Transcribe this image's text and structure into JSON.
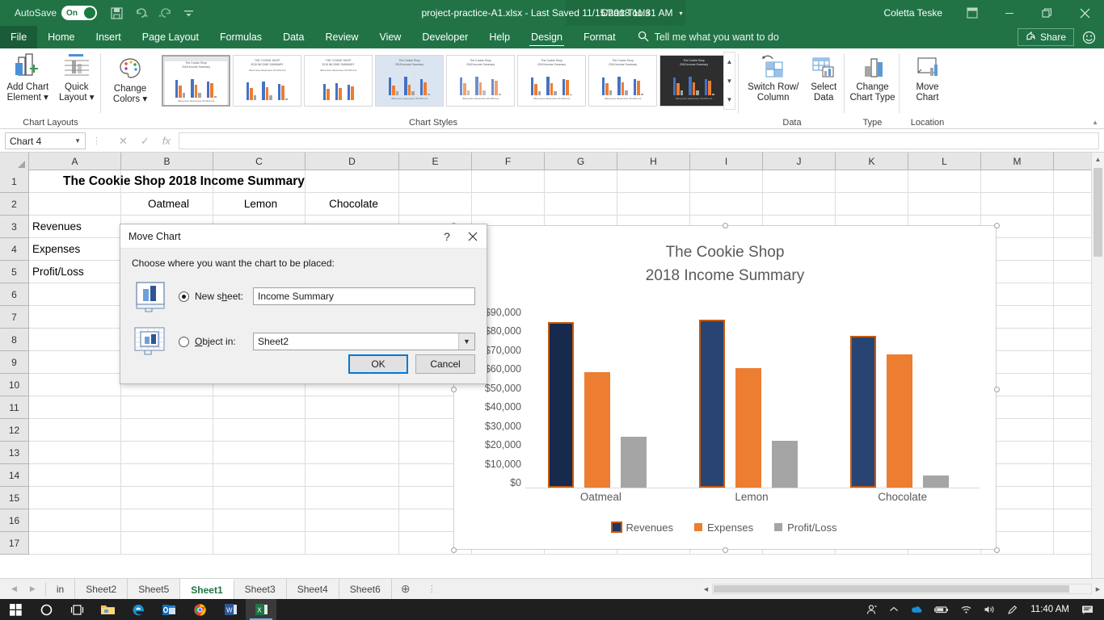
{
  "titlebar": {
    "autosave_label": "AutoSave",
    "autosave_state": "On",
    "document_title": "project-practice-A1.xlsx  -  Last Saved 11/15/2018 11:31 AM",
    "context_tab_group": "Chart Tools",
    "user_name": "Coletta Teske",
    "icons": {
      "save": "save-icon",
      "undo": "undo-icon",
      "redo": "redo-icon",
      "customize": "customize-qat-icon",
      "ribbon_display": "ribbon-display-options-icon",
      "minimize": "minimize-icon",
      "restore": "restore-icon",
      "close": "close-icon"
    }
  },
  "ribbon_tabs": {
    "items": [
      "File",
      "Home",
      "Insert",
      "Page Layout",
      "Formulas",
      "Data",
      "Review",
      "View",
      "Developer",
      "Help"
    ],
    "context_items": [
      "Design",
      "Format"
    ],
    "active_context": "Design",
    "tell_me": "Tell me what you want to do",
    "share_label": "Share"
  },
  "ribbon": {
    "groups": [
      {
        "name": "Chart Layouts",
        "label": "Chart Layouts",
        "buttons": [
          {
            "label_line1": "Add Chart",
            "label_line2": "Element",
            "dropdown": true,
            "icon": "add-chart-element-icon"
          },
          {
            "label_line1": "Quick",
            "label_line2": "Layout",
            "dropdown": true,
            "icon": "quick-layout-icon"
          }
        ]
      },
      {
        "name": "Chart Styles",
        "label": "Chart Styles",
        "buttons": [
          {
            "label_line1": "Change",
            "label_line2": "Colors",
            "dropdown": true,
            "icon": "change-colors-icon"
          }
        ],
        "gallery_count": 8,
        "selected_style_index": 0
      },
      {
        "name": "Data",
        "label": "Data",
        "buttons": [
          {
            "label_line1": "Switch Row/",
            "label_line2": "Column",
            "dropdown": false,
            "icon": "switch-row-column-icon"
          },
          {
            "label_line1": "Select",
            "label_line2": "Data",
            "dropdown": false,
            "icon": "select-data-icon"
          }
        ]
      },
      {
        "name": "Type",
        "label": "Type",
        "buttons": [
          {
            "label_line1": "Change",
            "label_line2": "Chart Type",
            "dropdown": false,
            "icon": "change-chart-type-icon"
          }
        ]
      },
      {
        "name": "Location",
        "label": "Location",
        "buttons": [
          {
            "label_line1": "Move",
            "label_line2": "Chart",
            "dropdown": false,
            "icon": "move-chart-icon"
          }
        ]
      }
    ]
  },
  "formula_bar": {
    "name_box_value": "Chart 4",
    "formula_value": "",
    "cancel_icon": "cancel-icon",
    "enter_icon": "enter-icon",
    "function_icon": "insert-function-icon"
  },
  "grid": {
    "columns": [
      "A",
      "B",
      "C",
      "D",
      "E",
      "F",
      "G",
      "H",
      "I",
      "J",
      "K",
      "L",
      "M"
    ],
    "rows": [
      "1",
      "2",
      "3",
      "4",
      "5",
      "6",
      "7",
      "8",
      "9",
      "10",
      "11",
      "12",
      "13",
      "14",
      "15",
      "16",
      "17"
    ],
    "cells": {
      "title_a1": "The Cookie Shop 2018 Income Summary",
      "header_b2": "Oatmeal",
      "header_c2": "Lemon",
      "header_d2": "Chocolate",
      "label_a3": "Revenues",
      "label_a4": "Expenses",
      "label_a5": "Profit/Loss"
    }
  },
  "chart_data": {
    "type": "bar",
    "title": "The Cookie Shop",
    "subtitle": "2018 Income Summary",
    "categories": [
      "Oatmeal",
      "Lemon",
      "Chocolate"
    ],
    "series": [
      {
        "name": "Revenues",
        "values": [
          82000,
          83000,
          75000
        ],
        "color": "#1F3864"
      },
      {
        "name": "Expenses",
        "values": [
          57000,
          59000,
          66000
        ],
        "color": "#ED7D31"
      },
      {
        "name": "Profit/Loss",
        "values": [
          25000,
          23000,
          6000
        ],
        "color": "#A5A5A5"
      }
    ],
    "ytick_labels": [
      "$90,000",
      "$80,000",
      "$70,000",
      "$60,000",
      "$50,000",
      "$40,000",
      "$30,000",
      "$20,000",
      "$10,000",
      "$0"
    ],
    "ylim": [
      0,
      90000
    ],
    "xlabel": "",
    "ylabel": "",
    "grid": false,
    "legend_position": "bottom",
    "selected_series": "Revenues",
    "selection_border_color": "#C55A11"
  },
  "dialog": {
    "title": "Move Chart",
    "help_icon": "help-icon",
    "close_icon": "close-icon",
    "prompt": "Choose where you want the chart to be placed:",
    "options": [
      {
        "label": "New sheet:",
        "label_pre": "New s",
        "label_mnemonic": "h",
        "label_post": "eet:",
        "selected": true,
        "value": "Income Summary",
        "icon": "new-sheet-chart-icon"
      },
      {
        "label": "Object in:",
        "label_pre": "",
        "label_mnemonic": "O",
        "label_post": "bject in:",
        "selected": false,
        "value": "Sheet2",
        "icon": "object-in-worksheet-icon"
      }
    ],
    "buttons": [
      {
        "label": "OK",
        "primary": true
      },
      {
        "label": "Cancel",
        "primary": false
      }
    ]
  },
  "sheet_tabs": {
    "items": [
      {
        "name": "in",
        "active": false
      },
      {
        "name": "Sheet2",
        "active": false
      },
      {
        "name": "Sheet5",
        "active": false
      },
      {
        "name": "Sheet1",
        "active": true
      },
      {
        "name": "Sheet3",
        "active": false
      },
      {
        "name": "Sheet4",
        "active": false
      },
      {
        "name": "Sheet6",
        "active": false
      }
    ],
    "add_sheet_icon": "add-sheet-icon",
    "prev_icon": "prev-sheet-icon",
    "next_icon": "next-sheet-icon"
  },
  "taskbar": {
    "items": [
      {
        "name": "start-icon"
      },
      {
        "name": "cortana-icon"
      },
      {
        "name": "task-view-icon"
      },
      {
        "name": "file-explorer-icon"
      },
      {
        "name": "edge-icon"
      },
      {
        "name": "outlook-icon"
      },
      {
        "name": "chrome-icon"
      },
      {
        "name": "word-icon"
      },
      {
        "name": "excel-icon"
      }
    ],
    "tray": [
      "people-icon",
      "show-hidden-icon",
      "onedrive-icon",
      "battery-icon",
      "wifi-icon",
      "volume-icon",
      "pen-icon"
    ],
    "clock": "11:40 AM",
    "notification_icon": "notifications-icon"
  }
}
